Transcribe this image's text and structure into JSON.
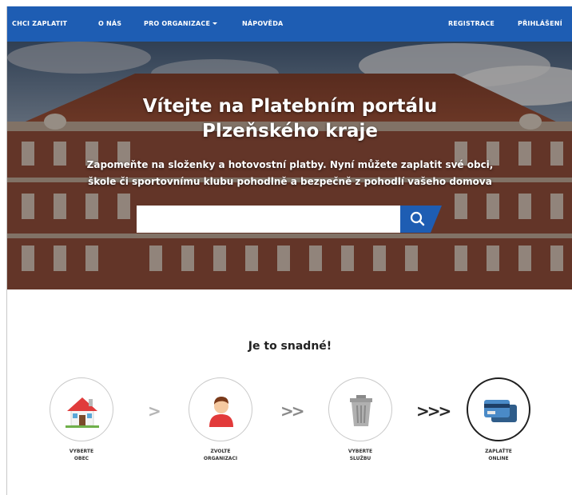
{
  "nav": {
    "items": [
      "CHCI ZAPLATIT",
      "O NÁS",
      "PRO ORGANIZACE",
      "NÁPOVĚDA"
    ],
    "right": [
      "REGISTRACE",
      "PŘIHLÁŠENÍ"
    ]
  },
  "hero": {
    "title_line1": "Vítejte na Platebním portálu",
    "title_line2": "Plzeňského kraje",
    "subtitle_line1": "Zapomeňte na složenky a hotovostní platby. Nyní můžete zaplatit své obci,",
    "subtitle_line2": "škole či sportovnímu klubu pohodlně a bezpečně z pohodlí vašeho domova",
    "search_value": ""
  },
  "main": {
    "section_title": "Je to snadné!",
    "arrows": [
      ">",
      ">>",
      ">>>"
    ],
    "steps": [
      {
        "line1": "VYBERTE",
        "line2": "OBEC",
        "icon": "house-icon"
      },
      {
        "line1": "ZVOLTE",
        "line2": "ORGANIZACI",
        "icon": "person-icon"
      },
      {
        "line1": "VYBERTE",
        "line2": "SLUŽBU",
        "icon": "trash-bin-icon"
      },
      {
        "line1": "ZAPLAŤTE",
        "line2": "ONLINE",
        "icon": "credit-card-icon"
      }
    ]
  },
  "colors": {
    "nav_bg": "#1e5db3",
    "search_button": "#1e5db3"
  }
}
